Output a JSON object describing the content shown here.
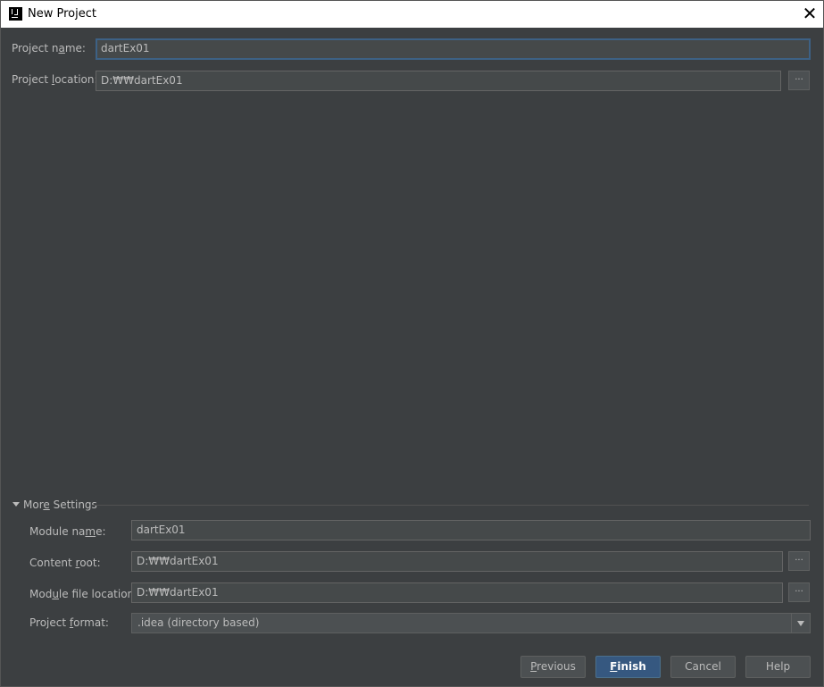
{
  "window": {
    "title": "New Project"
  },
  "project": {
    "name_label": {
      "pre": "Project n",
      "mn": "a",
      "post": "me:"
    },
    "name_value": "dartEx01",
    "location_label": {
      "pre": "Project ",
      "mn": "l",
      "post": "ocation:"
    },
    "location_value": "D:₩₩dartEx01",
    "browse_label": "..."
  },
  "more_settings": {
    "title": {
      "pre": "Mor",
      "mn": "e",
      "post": " Settings"
    },
    "module_name_label": {
      "pre": "Module na",
      "mn": "m",
      "post": "e:"
    },
    "module_name_value": "dartEx01",
    "content_root_label": {
      "pre": "Content ",
      "mn": "r",
      "post": "oot:"
    },
    "content_root_value": "D:₩₩dartEx01",
    "module_file_label": {
      "pre": "Mod",
      "mn": "u",
      "post": "le file location:"
    },
    "module_file_value": "D:₩₩dartEx01",
    "project_format_label": {
      "pre": "Project ",
      "mn": "f",
      "post": "ormat:"
    },
    "project_format_value": ".idea (directory based)"
  },
  "buttons": {
    "previous": {
      "pre": "",
      "mn": "P",
      "post": "revious"
    },
    "finish": {
      "pre": "",
      "mn": "F",
      "post": "inish"
    },
    "cancel": "Cancel",
    "help": "Help"
  },
  "colors": {
    "background": "#3c3f41",
    "field_bg": "#45494a",
    "focus_border": "#3d6185",
    "primary_button": "#365880",
    "text": "#bbbbbb"
  },
  "icons": {
    "app": "intellij-icon",
    "close": "close-icon",
    "collapse": "triangle-down-icon",
    "dropdown": "chevron-down-icon"
  }
}
